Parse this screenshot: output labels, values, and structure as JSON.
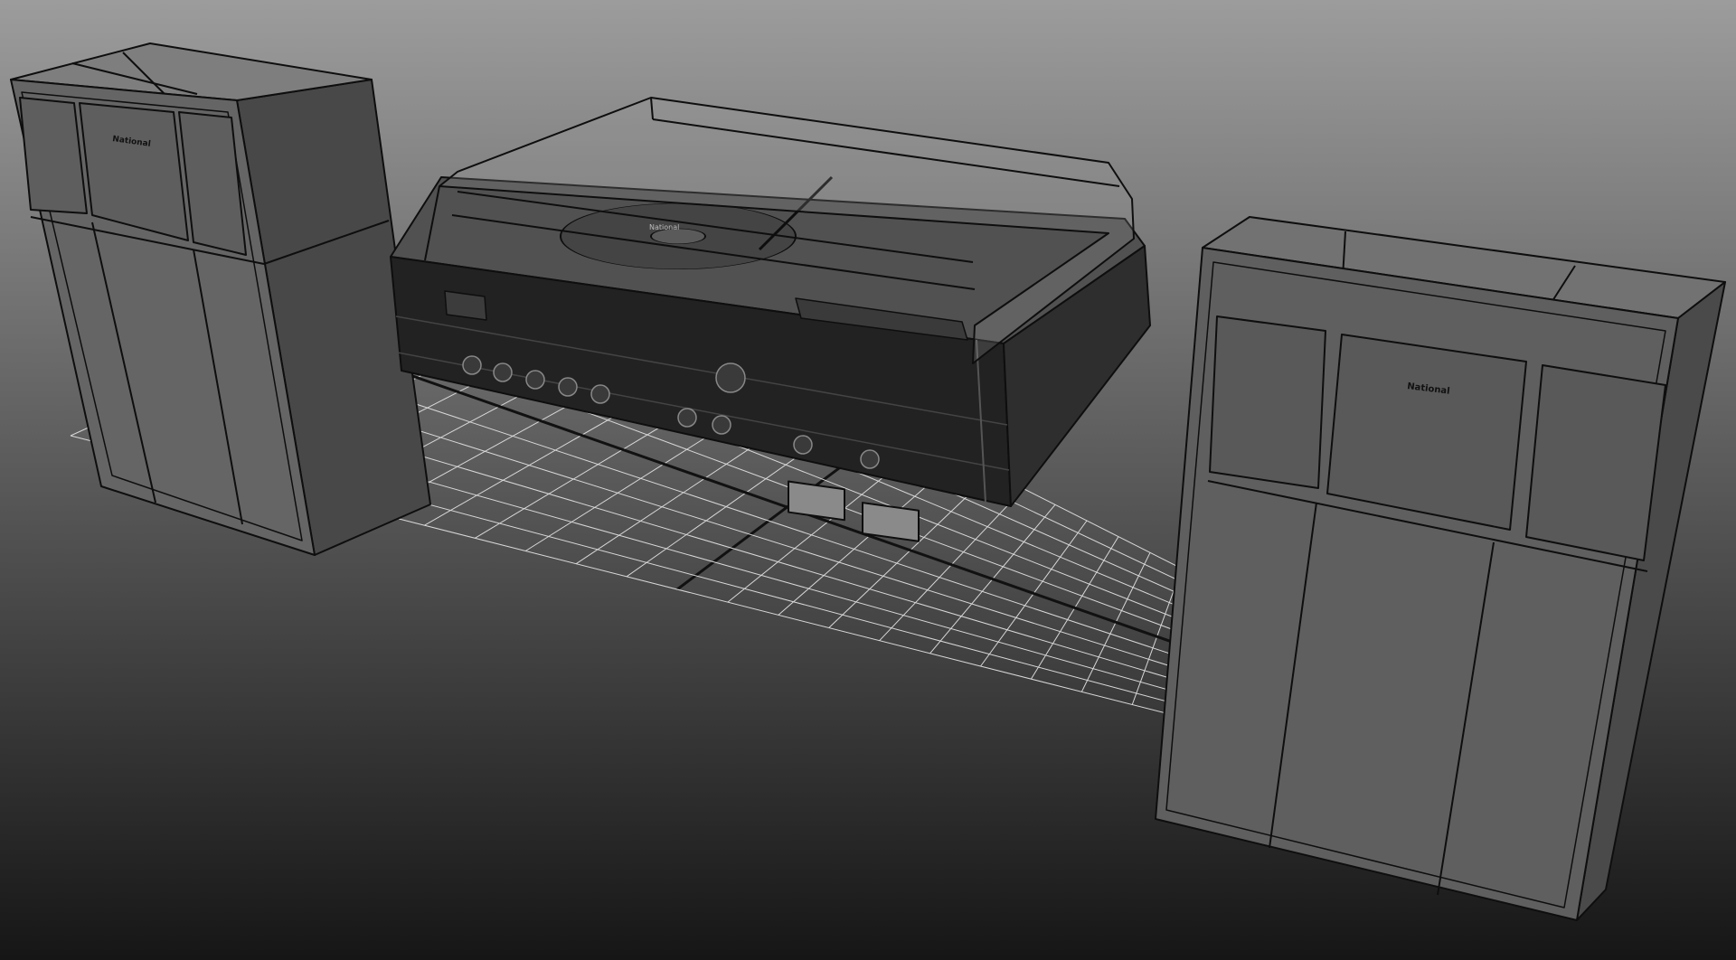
{
  "viewport": {
    "background_top": "#9c9c9c",
    "background_bottom": "#161616",
    "grid_color": "#d8d8d8",
    "grid_axis_color": "#111111",
    "wire_color": "#101010",
    "shade_color": "#555555"
  },
  "scene": {
    "objects": [
      {
        "name": "speaker-left",
        "badge": "National"
      },
      {
        "name": "stereo-console",
        "badge": "National"
      },
      {
        "name": "speaker-right",
        "badge": "National"
      }
    ]
  }
}
